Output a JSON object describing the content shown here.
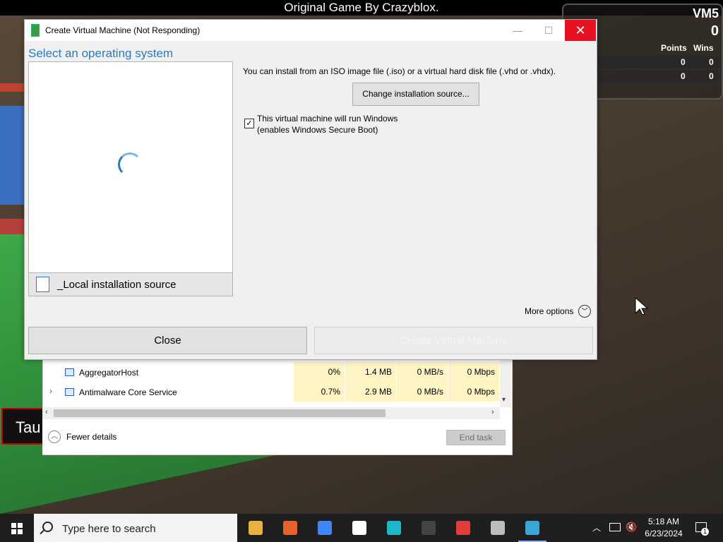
{
  "game": {
    "title": "Original Game By Crazyblox.",
    "score": {
      "player": "VM5",
      "big_value": "0",
      "col_points": "Points",
      "col_wins": "Wins",
      "rows": [
        {
          "points": "0",
          "wins": "0"
        },
        {
          "points": "0",
          "wins": "0"
        }
      ]
    },
    "taunt": "Tau"
  },
  "dialog": {
    "title": "Create Virtual Machine (Not Responding)",
    "heading": "Select an operating system",
    "local_source": "_Local installation source",
    "install_text": "You can install from an ISO image file (.iso) or a virtual hard disk file (.vhd or .vhdx).",
    "change_source_button": "Change installation source...",
    "windows_checkbox": {
      "checked": true,
      "check_glyph": "✓",
      "line1": "This virtual machine will run Windows",
      "line2": "(enables Windows Secure Boot)"
    },
    "more_options": "More options",
    "close_button": "Close",
    "create_button": "Create Virtual Machine"
  },
  "taskmgr": {
    "rows": [
      {
        "name": "AggregatorHost",
        "cpu": "0%",
        "memory": "1.4 MB",
        "disk": "0 MB/s",
        "network": "0 Mbps",
        "expandable": false
      },
      {
        "name": "Antimalware Core Service",
        "cpu": "0.7%",
        "memory": "2.9 MB",
        "disk": "0 MB/s",
        "network": "0 Mbps",
        "expandable": true
      }
    ],
    "fewer_details": "Fewer details",
    "end_task": "End task"
  },
  "taskbar": {
    "search_placeholder": "Type here to search",
    "apps": [
      {
        "name": "file-explorer-icon",
        "color": "#e8b33c"
      },
      {
        "name": "firefox-icon",
        "color": "#e8632b"
      },
      {
        "name": "chrome-icon",
        "color": "#4285f4"
      },
      {
        "name": "7zip-icon",
        "color": "#ffffff"
      },
      {
        "name": "vpn-icon",
        "color": "#1fb6c7"
      },
      {
        "name": "steam-icon",
        "color": "#444444"
      },
      {
        "name": "roblox-studio-icon",
        "color": "#e23d3d"
      },
      {
        "name": "remote-desktop-icon",
        "color": "#bcbcbc"
      },
      {
        "name": "hyper-v-icon",
        "color": "#3aa6d8"
      }
    ],
    "time": "5:18 AM",
    "date": "6/23/2024",
    "notification_count": "1"
  },
  "colors": {
    "accent": "#2c7bb6",
    "close_red": "#e81123",
    "taskbar_bg": "#1f1f1f"
  }
}
